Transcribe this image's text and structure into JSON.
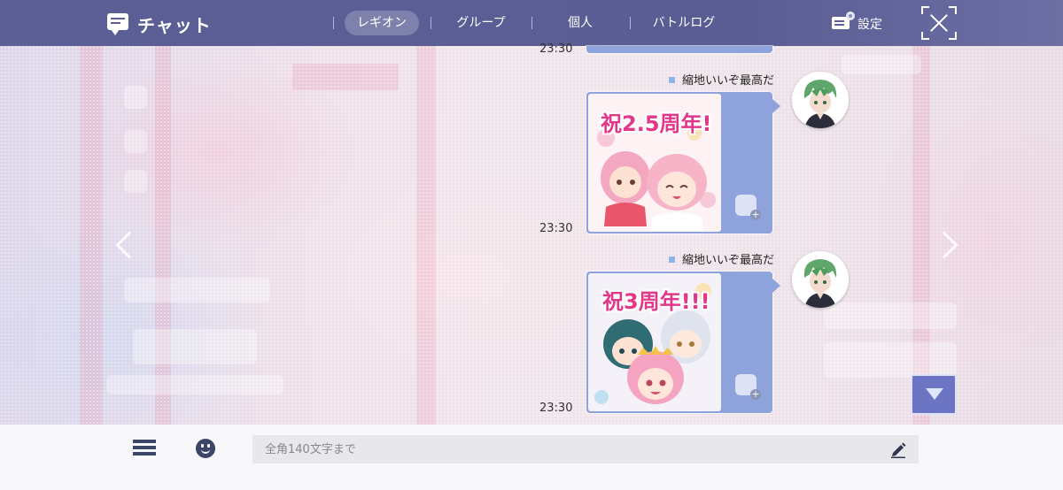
{
  "header": {
    "title": "チャット",
    "tabs": [
      {
        "label": "レギオン",
        "active": true
      },
      {
        "label": "グループ",
        "active": false
      },
      {
        "label": "個人",
        "active": false
      },
      {
        "label": "バトルログ",
        "active": false
      }
    ],
    "settings_label": "設定"
  },
  "messages": [
    {
      "time": "23:30",
      "sender": "",
      "stamp_text": ""
    },
    {
      "time": "23:30",
      "sender": "縮地いいぞ最高だ",
      "stamp_text": "祝2.5周年!"
    },
    {
      "time": "23:30",
      "sender": "縮地いいぞ最高だ",
      "stamp_text": "祝3周年!!!"
    }
  ],
  "footer": {
    "input_placeholder": "全角140文字まで"
  },
  "colors": {
    "header_bg": "#5b5f95",
    "bubble_bg": "#8ea3dc",
    "scroll_button": "#6c74c4",
    "footer_bg": "#f8f8fa",
    "stamp_text": "#e2388a"
  },
  "icons": [
    "chat-icon",
    "settings-icon",
    "close-icon",
    "stamp-add-icon",
    "scroll-down-icon",
    "list-icon",
    "emoji-icon",
    "pen-icon"
  ]
}
